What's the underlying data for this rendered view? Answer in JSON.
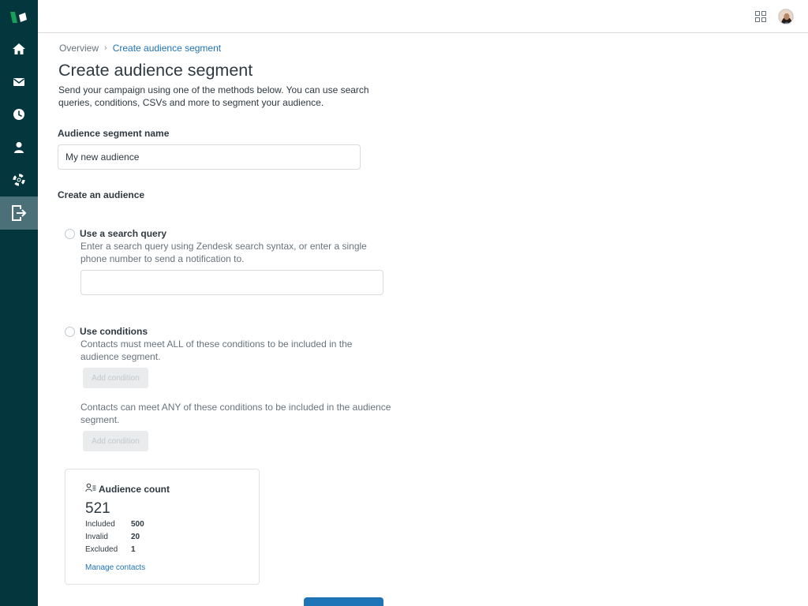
{
  "sidebar": {
    "items": [
      {
        "icon": "home-icon",
        "active": false
      },
      {
        "icon": "mail-icon",
        "active": false
      },
      {
        "icon": "clock-icon",
        "active": false
      },
      {
        "icon": "user-icon",
        "active": false
      },
      {
        "icon": "lifebuoy-icon",
        "active": false
      },
      {
        "icon": "campaign-exit-icon",
        "active": true
      }
    ]
  },
  "topbar": {
    "apps_icon": "grid-apps-icon",
    "avatar_icon": "user-avatar"
  },
  "breadcrumb": {
    "overview": "Overview",
    "current": "Create audience segment"
  },
  "page": {
    "title": "Create audience segment",
    "description": "Send your campaign using one of the methods below. You can use search queries, conditions, CSVs and more to segment your audience."
  },
  "segment_name": {
    "label": "Audience segment name",
    "value": "My new audience"
  },
  "create_audience": {
    "heading": "Create an audience",
    "search_query": {
      "label": "Use a search query",
      "hint": "Enter a search query using Zendesk search syntax, or enter a single phone number to send a notification to.",
      "value": ""
    },
    "conditions": {
      "label": "Use conditions",
      "all_hint": "Contacts must meet ALL of these conditions to be included in the audience segment.",
      "all_button": "Add condition",
      "any_hint": "Contacts can meet ANY of these conditions to be included in the audience segment.",
      "any_button": "Add condition"
    }
  },
  "audience_count": {
    "title": "Audience count",
    "total": "521",
    "stats": [
      {
        "label": "Included",
        "value": "500"
      },
      {
        "label": "Invalid",
        "value": "20"
      },
      {
        "label": "Excluded",
        "value": "1"
      }
    ],
    "link": "Manage contacts"
  },
  "colors": {
    "sidebar": "#03363d",
    "sidebar_active": "#4c7077",
    "link": "#1f73b7",
    "logo_green": "#17a05a"
  }
}
